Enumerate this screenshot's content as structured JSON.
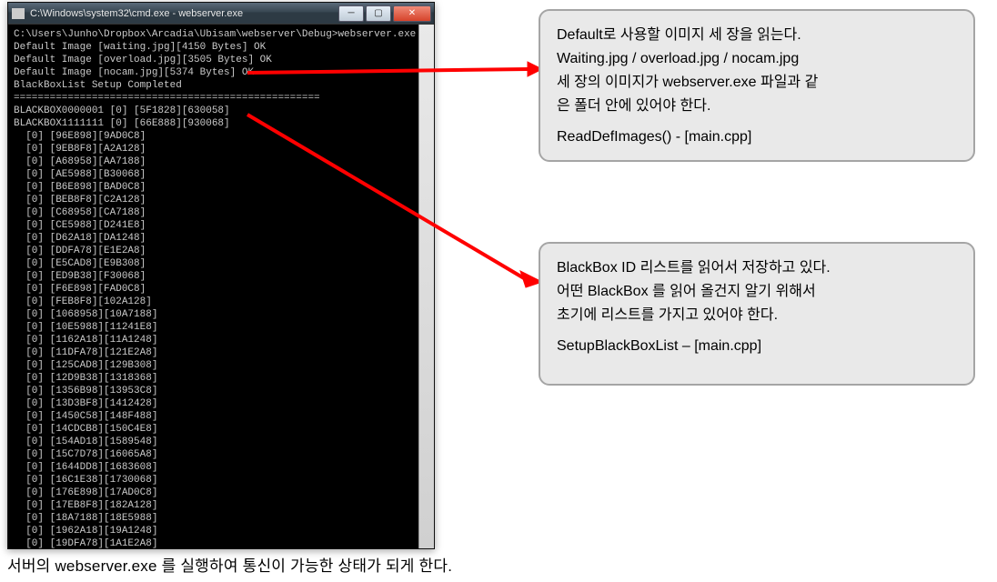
{
  "window": {
    "title": "C:\\Windows\\system32\\cmd.exe - webserver.exe",
    "buttons": {
      "min": "─",
      "max": "▢",
      "close": "✕"
    }
  },
  "terminal": {
    "header": [
      "C:\\Users\\Junho\\Dropbox\\Arcadia\\Ubisam\\webserver\\Debug>webserver.exe",
      "Default Image [waiting.jpg][4150 Bytes] OK",
      "Default Image [overload.jpg][3505 Bytes] OK",
      "Default Image [nocam.jpg][5374 Bytes] OK",
      "BlackBoxList Setup Completed",
      "===================================================",
      "BLACKBOX0000001 [0] [5F1828][630058]",
      "BLACKBOX1111111 [0] [66E888][930068]"
    ],
    "rows": [
      "  [0] [96E898][9AD0C8]",
      "  [0] [9EB8F8][A2A128]",
      "  [0] [A68958][AA7188]",
      "  [0] [AE5988][B30068]",
      "  [0] [B6E898][BAD0C8]",
      "  [0] [BEB8F8][C2A128]",
      "  [0] [C68958][CA7188]",
      "  [0] [CE5988][D241E8]",
      "  [0] [D62A18][DA1248]",
      "  [0] [DDFA78][E1E2A8]",
      "  [0] [E5CAD8][E9B308]",
      "  [0] [ED9B38][F30068]",
      "  [0] [F6E898][FAD0C8]",
      "  [0] [FEB8F8][102A128]",
      "  [0] [1068958][10A7188]",
      "  [0] [10E5988][11241E8]",
      "  [0] [1162A18][11A1248]",
      "  [0] [11DFA78][121E2A8]",
      "  [0] [125CAD8][129B308]",
      "  [0] [12D9B38][1318368]",
      "  [0] [1356B98][13953C8]",
      "  [0] [13D3BF8][1412428]",
      "  [0] [1450C58][148F488]",
      "  [0] [14CDCB8][150C4E8]",
      "  [0] [154AD18][1589548]",
      "  [0] [15C7D78][16065A8]",
      "  [0] [1644DD8][1683608]",
      "  [0] [16C1E38][1730068]",
      "  [0] [176E898][17AD0C8]",
      "  [0] [17EB8F8][182A128]",
      "  [0] [18A7188][18E5988]",
      "  [0] [1962A18][19A1248]",
      "  [0] [19DFA78][1A1E2A8]"
    ]
  },
  "callout1": {
    "l1": "Default로 사용할 이미지 세 장을 읽는다.",
    "l2": "Waiting.jpg / overload.jpg / nocam.jpg",
    "l3": "세 장의 이미지가 webserver.exe 파일과 같",
    "l4": "은 폴더 안에 있어야 한다.",
    "l5": "ReadDefImages() - [main.cpp]"
  },
  "callout2": {
    "l1": "BlackBox ID 리스트를 읽어서 저장하고 있다.",
    "l2": "어떤 BlackBox 를 읽어 올건지 알기 위해서",
    "l3": "초기에 리스트를 가지고 있어야 한다.",
    "l4": "SetupBlackBoxList – [main.cpp]"
  },
  "caption": "서버의 webserver.exe 를 실행하여 통신이 가능한 상태가 되게 한다."
}
